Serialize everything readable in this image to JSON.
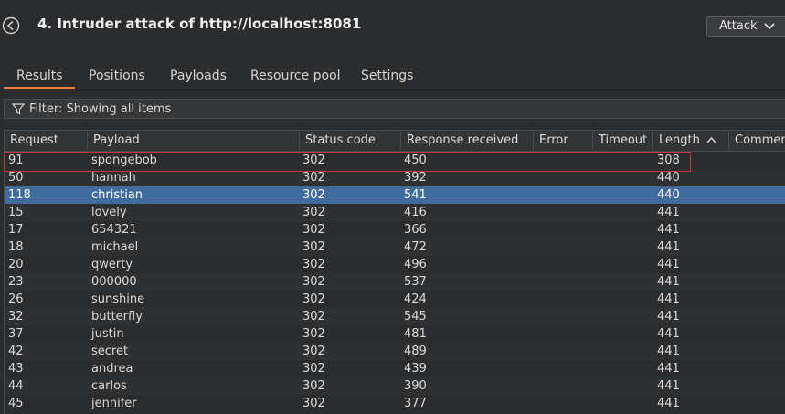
{
  "window": {
    "title": "4. Intruder attack of http://localhost:8081",
    "attack_button": "Attack"
  },
  "tabs": [
    {
      "label": "Results",
      "active": true
    },
    {
      "label": "Positions"
    },
    {
      "label": "Payloads"
    },
    {
      "label": "Resource pool"
    },
    {
      "label": "Settings"
    }
  ],
  "filter": {
    "text": "Filter: Showing all items"
  },
  "table": {
    "columns": [
      "Request",
      "Payload",
      "Status code",
      "Response received",
      "Error",
      "Timeout",
      "Length",
      "Comment"
    ],
    "sort_column": "Length",
    "sort_direction": "ascending",
    "highlighted_row": 0,
    "selected_row": 2,
    "rows": [
      [
        "91",
        "spongebob",
        "302",
        "450",
        "",
        "",
        "308",
        ""
      ],
      [
        "50",
        "hannah",
        "302",
        "392",
        "",
        "",
        "440",
        ""
      ],
      [
        "118",
        "christian",
        "302",
        "541",
        "",
        "",
        "440",
        ""
      ],
      [
        "15",
        "lovely",
        "302",
        "416",
        "",
        "",
        "441",
        ""
      ],
      [
        "17",
        "654321",
        "302",
        "366",
        "",
        "",
        "441",
        ""
      ],
      [
        "18",
        "michael",
        "302",
        "472",
        "",
        "",
        "441",
        ""
      ],
      [
        "20",
        "qwerty",
        "302",
        "496",
        "",
        "",
        "441",
        ""
      ],
      [
        "23",
        "000000",
        "302",
        "537",
        "",
        "",
        "441",
        ""
      ],
      [
        "26",
        "sunshine",
        "302",
        "424",
        "",
        "",
        "441",
        ""
      ],
      [
        "32",
        "butterfly",
        "302",
        "545",
        "",
        "",
        "441",
        ""
      ],
      [
        "37",
        "justin",
        "302",
        "481",
        "",
        "",
        "441",
        ""
      ],
      [
        "42",
        "secret",
        "302",
        "489",
        "",
        "",
        "441",
        ""
      ],
      [
        "43",
        "andrea",
        "302",
        "439",
        "",
        "",
        "441",
        ""
      ],
      [
        "44",
        "carlos",
        "302",
        "390",
        "",
        "",
        "441",
        ""
      ],
      [
        "45",
        "jennifer",
        "302",
        "377",
        "",
        "",
        "441",
        ""
      ]
    ]
  },
  "colors": {
    "background": "#2b2c2e",
    "selected_row": "#3f6b9d",
    "highlight_border": "#c8323a",
    "active_tab_underline": "#e5833d"
  }
}
